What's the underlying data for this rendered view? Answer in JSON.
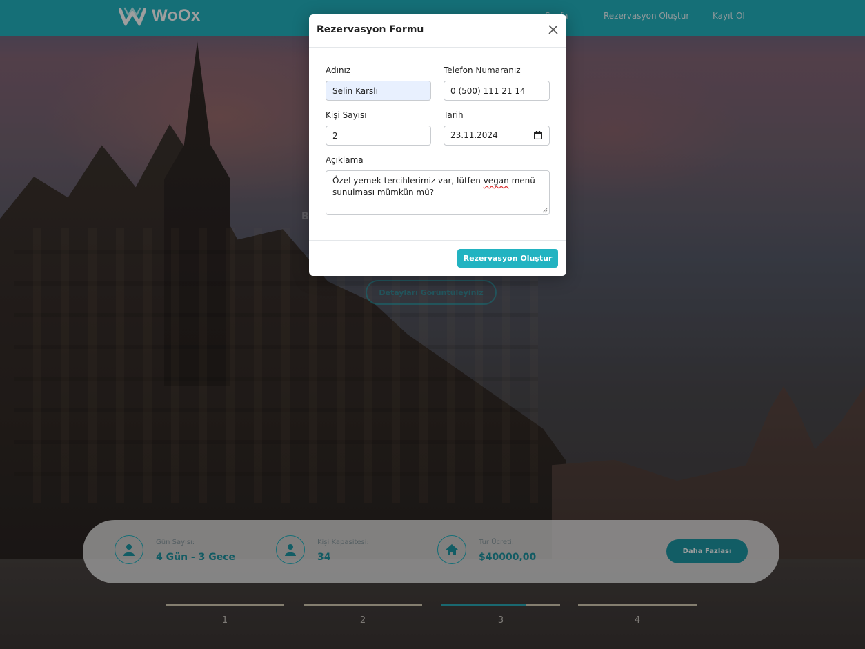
{
  "brand": {
    "name": "WoOx",
    "accent": "#22b3c1"
  },
  "nav": {
    "home": "Sayfa",
    "create_reservation": "Rezervasyon Oluştur",
    "signup": "Kayıt Ol"
  },
  "hero": {
    "partial_letter": "B",
    "cta_partial": "Detayları Görüntüleyiniz"
  },
  "info_bar": {
    "days": {
      "label": "Gün Sayısı:",
      "value": "4 Gün - 3 Gece",
      "icon": "user-icon"
    },
    "capacity": {
      "label": "Kişi Kapasitesi:",
      "value": "34",
      "icon": "user-icon"
    },
    "price": {
      "label": "Tur Ücreti:",
      "value": "$40000,00",
      "icon": "home-icon"
    },
    "more_button": "Daha Fazlası"
  },
  "pager": {
    "pages": [
      "1",
      "2",
      "3",
      "4"
    ],
    "active": "3"
  },
  "modal": {
    "title": "Rezervasyon Formu",
    "fields": {
      "name": {
        "label": "Adınız",
        "value": "Selin Karslı"
      },
      "phone": {
        "label": "Telefon Numaranız",
        "value": "0 (500) 111 21 14"
      },
      "guests": {
        "label": "Kişi Sayısı",
        "value": "2"
      },
      "date": {
        "label": "Tarih",
        "value": "23.11.2024"
      },
      "description": {
        "label": "Açıklama",
        "value_before": "Özel yemek tercihlerimiz var, lütfen ",
        "value_misspelled": "vegan",
        "value_after": " menü sunulması mümkün mü?"
      }
    },
    "submit": "Rezervasyon Oluştur"
  }
}
